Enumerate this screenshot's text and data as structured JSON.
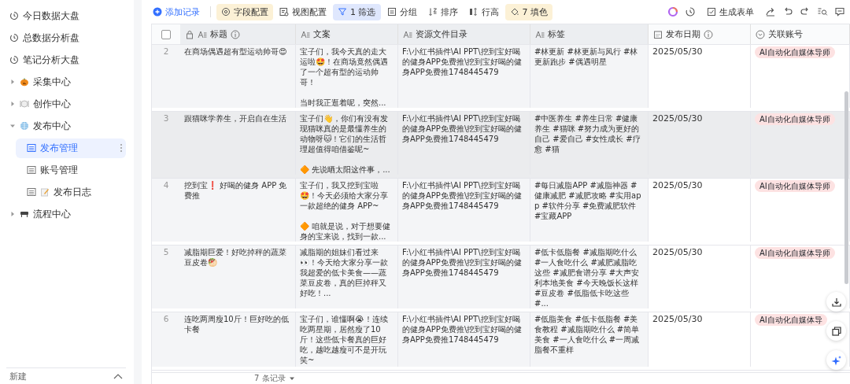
{
  "sidebar": {
    "items": [
      {
        "kind": "dashboard",
        "label": "今日数据大盘",
        "selected": false
      },
      {
        "kind": "dashboard",
        "label": "总数据分析盘",
        "selected": false
      },
      {
        "kind": "dashboard",
        "label": "笔记分析大盘",
        "selected": false
      },
      {
        "kind": "folder",
        "label": "采集中心",
        "expanded": false,
        "selected": false
      },
      {
        "kind": "folder",
        "label": "创作中心",
        "expanded": false,
        "selected": false
      },
      {
        "kind": "folder",
        "label": "发布中心",
        "expanded": true,
        "selected": false,
        "children": [
          {
            "kind": "table",
            "label": "发布管理",
            "selected": true
          },
          {
            "kind": "table",
            "label": "账号管理",
            "selected": false
          },
          {
            "kind": "table",
            "label": "发布日志",
            "selected": false
          }
        ]
      },
      {
        "kind": "folder",
        "label": "流程中心",
        "expanded": false,
        "selected": false
      }
    ],
    "new_label": "新建"
  },
  "toolbar": {
    "left": [
      {
        "kind": "add",
        "label": "添加记录",
        "highlighted": false
      },
      {
        "kind": "fields",
        "label": "字段配置",
        "highlighted": true,
        "color": "#fcf1d6"
      },
      {
        "kind": "view",
        "label": "视图配置",
        "highlighted": false
      },
      {
        "kind": "filter",
        "label": "1 筛选",
        "highlighted": true,
        "color": "#dfe7fd"
      },
      {
        "kind": "group",
        "label": "分组",
        "highlighted": false
      },
      {
        "kind": "sort",
        "label": "排序",
        "highlighted": false
      },
      {
        "kind": "height",
        "label": "行高",
        "highlighted": false
      },
      {
        "kind": "fill",
        "label": "7 填色",
        "highlighted": true,
        "color": "#fcf1d6"
      }
    ],
    "right": [
      {
        "kind": "ai"
      },
      {
        "kind": "history"
      },
      {
        "kind": "form",
        "label": "生成表单"
      },
      {
        "kind": "share"
      },
      {
        "kind": "undo"
      },
      {
        "kind": "redo"
      },
      {
        "kind": "search"
      },
      {
        "kind": "comment"
      }
    ]
  },
  "table": {
    "select_all": {
      "checked": false
    },
    "columns": [
      {
        "kind": "text",
        "label": "标题",
        "locked": true,
        "info": true,
        "shaded": true
      },
      {
        "kind": "text",
        "label": "文案",
        "locked": false,
        "info": false,
        "shaded": true
      },
      {
        "kind": "text",
        "label": "资源文件目录",
        "locked": false,
        "info": false,
        "shaded": true
      },
      {
        "kind": "text",
        "label": "标签",
        "locked": false,
        "info": false,
        "shaded": true
      },
      {
        "kind": "date",
        "label": "发布日期",
        "locked": false,
        "info": true,
        "shaded": false
      },
      {
        "kind": "select",
        "label": "关联账号",
        "locked": false,
        "info": false,
        "shaded": false
      }
    ],
    "rows": [
      {
        "number": "2",
        "highlighted": false,
        "title": "在商场偶遇超有型运动帅哥😍",
        "copy": [
          "宝子们，我今天真的走大运啦🤩！在商场竟然偶遇了一个超有型的运动帅哥！",
          "当时我正逛着呢，突然..."
        ],
        "path": "F:\\小红书插件\\AI PPT\\挖到宝好喝的健身APP免费推\\挖到宝好喝的健身APP免费推1748445479",
        "tags": "#林更新  #林更新与凤行  #林更新跑步  #偶遇明星",
        "date": "2025/05/30",
        "account": "AI自动化自媒体导师"
      },
      {
        "number": "3",
        "highlighted": true,
        "title": "跟猫咪学养生，开启自在生活",
        "copy": [
          "宝子们👋，你们有没有发现猫咪真的是最懂养生的动物呀🐱！它们的生活哲理超值得咱借鉴呢~",
          "🔶 先说晒太阳这件事，..."
        ],
        "path": "F:\\小红书插件\\AI PPT\\挖到宝好喝的健身APP免费推\\挖到宝好喝的健身APP免费推1748445479",
        "tags": "#中医养生  #养生日常  #健康养生  #猫咪  #努力成为更好的自己  #爱自己  #女性成长  #疗愈  #猫",
        "date": "2025/05/30",
        "account": "AI自动化自媒体导师"
      },
      {
        "number": "4",
        "highlighted": false,
        "title": "挖到宝❗ 好喝的健身 APP 免费推",
        "copy": [
          "宝子们，我又挖到宝啦🤩！今天必须给大家分享一款超绝的健身 APP~",
          "🔶 咱就是说，对于想要健身的宝来说，找到一款..."
        ],
        "path": "F:\\小红书插件\\AI PPT\\挖到宝好喝的健身APP免费推\\挖到宝好喝的健身APP免费推1748445479",
        "tags": "#每日减脂APP  #减脂神器  #健康减肥  #减肥攻略  #实用app  #软件分享  #免费减肥软件  #宝藏APP",
        "date": "2025/05/30",
        "account": "AI自动化自媒体导师"
      },
      {
        "number": "5",
        "highlighted": false,
        "title": "减脂期巨爱！好吃掉秤的蔬菜豆皮卷🥙",
        "copy": [
          "减脂期的姐妹们看过来👀！今天给大家分享一款我超爱的低卡美食——蔬菜豆皮卷，真的巨掉秤又好吃！..."
        ],
        "path": "F:\\小红书插件\\AI PPT\\挖到宝好喝的健身APP免费推\\挖到宝好喝的健身APP免费推1748445479",
        "tags": "#低卡低脂餐  #减脂期吃什么  #一人食吃什么  #减肥减脂吃这些  #减肥食谱分享  #大声安利本地美食  #今天晚饭长这样  #豆皮卷  #低脂低卡吃这些  #...",
        "date": "2025/05/30",
        "account": "AI自动化自媒体导师"
      },
      {
        "number": "6",
        "highlighted": false,
        "title": "连吃两周瘦10斤！巨好吃的低卡餐",
        "copy": [
          "宝子们，谁懂啊😭！连续吃两星期，居然瘦了10斤！这些低卡餐真的巨好吃，越吃越瘦可不是开玩笑~"
        ],
        "path": "F:\\小红书插件\\AI PPT\\挖到宝好喝的健身APP免费推\\挖到宝好喝的健身APP免费推1748445479",
        "tags": "#低脂美食  #低卡低脂餐  #美食教程  #减脂期吃什么  #简单美食  #一人食吃什么  #一周减脂餐不重样",
        "date": "2025/05/30",
        "account": "AI自动化自媒体导"
      }
    ],
    "record_count": "7 条记录"
  },
  "floating": [
    {
      "kind": "download"
    },
    {
      "kind": "copy"
    },
    {
      "kind": "ai"
    }
  ]
}
